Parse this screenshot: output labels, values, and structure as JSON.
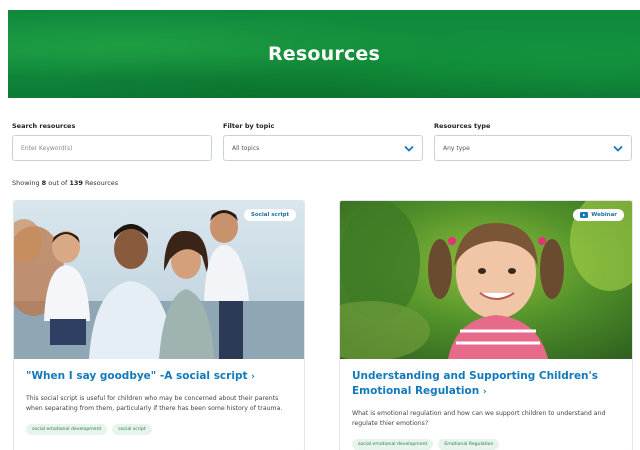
{
  "hero": {
    "title": "Resources"
  },
  "filters": {
    "search": {
      "label": "Search resources",
      "placeholder": "Enter Keyword(s)"
    },
    "topic": {
      "label": "Filter by topic",
      "value": "All topics"
    },
    "type": {
      "label": "Resources type",
      "value": "Any type"
    }
  },
  "results": {
    "prefix": "Showing",
    "shown": "8",
    "middle": "out of",
    "total": "139",
    "suffix": "Resources"
  },
  "cards": [
    {
      "badge": "Social script",
      "badge_icon": "none",
      "title": "\"When I say goodbye\" -A social script",
      "arrow": "›",
      "description": "This social script is useful for children who may be concerned about their parents when separating from them, particularly if there has been some history of trauma.",
      "tags": [
        "social emotional development",
        "social script"
      ]
    },
    {
      "badge": "Webinar",
      "badge_icon": "video-icon",
      "title": "Understanding and Supporting Children's Emotional Regulation",
      "arrow": "›",
      "description": "What is emotional regulation and how can we support children to understand and regulate thier emotions?",
      "tags": [
        "social emotional development",
        "Emotional Regulation"
      ]
    }
  ],
  "colors": {
    "brand_green": "#0f8a3c",
    "link_blue": "#127abb",
    "tag_bg": "#e7f4ec"
  }
}
